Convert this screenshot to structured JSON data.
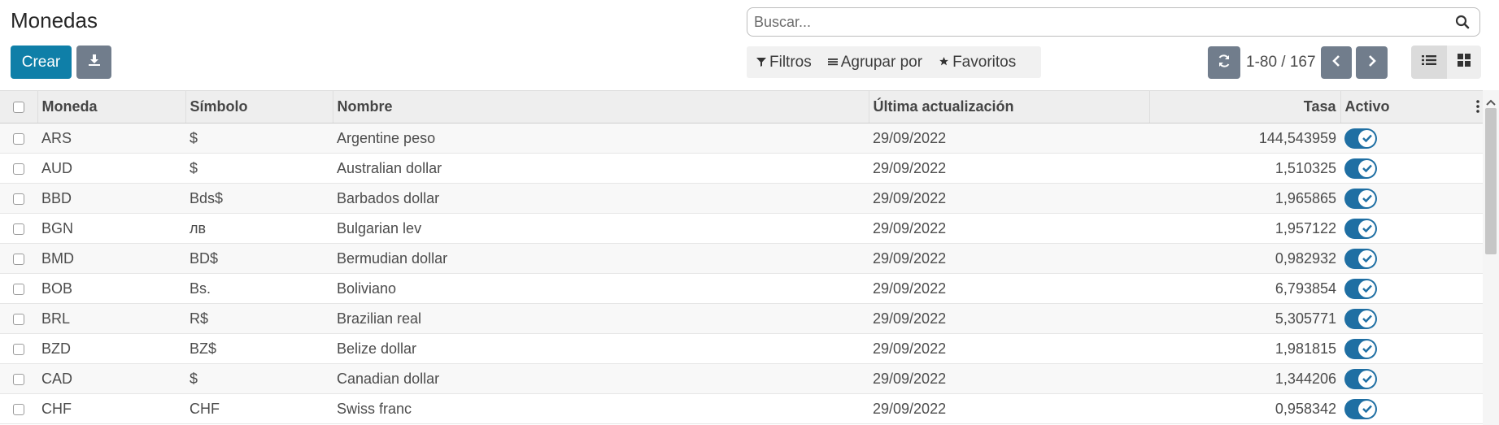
{
  "page": {
    "title": "Monedas"
  },
  "search": {
    "placeholder": "Buscar..."
  },
  "toolbar": {
    "create_label": "Crear"
  },
  "filters": {
    "filters_label": "Filtros",
    "group_label": "Agrupar por",
    "favorites_label": "Favoritos"
  },
  "pager": {
    "text": "1-80 / 167"
  },
  "table": {
    "headers": {
      "currency": "Moneda",
      "symbol": "Símbolo",
      "name": "Nombre",
      "updated": "Última actualización",
      "rate": "Tasa",
      "active": "Activo"
    },
    "rows": [
      {
        "currency": "ARS",
        "symbol": "$",
        "name": "Argentine peso",
        "updated": "29/09/2022",
        "rate": "144,543959",
        "active": true
      },
      {
        "currency": "AUD",
        "symbol": "$",
        "name": "Australian dollar",
        "updated": "29/09/2022",
        "rate": "1,510325",
        "active": true
      },
      {
        "currency": "BBD",
        "symbol": "Bds$",
        "name": "Barbados dollar",
        "updated": "29/09/2022",
        "rate": "1,965865",
        "active": true
      },
      {
        "currency": "BGN",
        "symbol": "лв",
        "name": "Bulgarian lev",
        "updated": "29/09/2022",
        "rate": "1,957122",
        "active": true
      },
      {
        "currency": "BMD",
        "symbol": "BD$",
        "name": "Bermudian dollar",
        "updated": "29/09/2022",
        "rate": "0,982932",
        "active": true
      },
      {
        "currency": "BOB",
        "symbol": "Bs.",
        "name": "Boliviano",
        "updated": "29/09/2022",
        "rate": "6,793854",
        "active": true
      },
      {
        "currency": "BRL",
        "symbol": "R$",
        "name": "Brazilian real",
        "updated": "29/09/2022",
        "rate": "5,305771",
        "active": true
      },
      {
        "currency": "BZD",
        "symbol": "BZ$",
        "name": "Belize dollar",
        "updated": "29/09/2022",
        "rate": "1,981815",
        "active": true
      },
      {
        "currency": "CAD",
        "symbol": "$",
        "name": "Canadian dollar",
        "updated": "29/09/2022",
        "rate": "1,344206",
        "active": true
      },
      {
        "currency": "CHF",
        "symbol": "CHF",
        "name": "Swiss franc",
        "updated": "29/09/2022",
        "rate": "0,958342",
        "active": true
      }
    ]
  },
  "icons": {
    "search": "search-icon",
    "export": "download-icon",
    "filter": "filter-icon",
    "group": "list-lines-icon",
    "favorites": "star-icon",
    "refresh": "refresh-icon",
    "prev": "chevron-left-icon",
    "next": "chevron-right-icon",
    "list_view": "list-view-icon",
    "kanban_view": "kanban-view-icon",
    "options": "vertical-dots-icon",
    "check": "check-icon"
  },
  "colors": {
    "primary": "#0f7fa8",
    "secondary": "#717d8c",
    "toggle_on": "#1f6fa3"
  }
}
